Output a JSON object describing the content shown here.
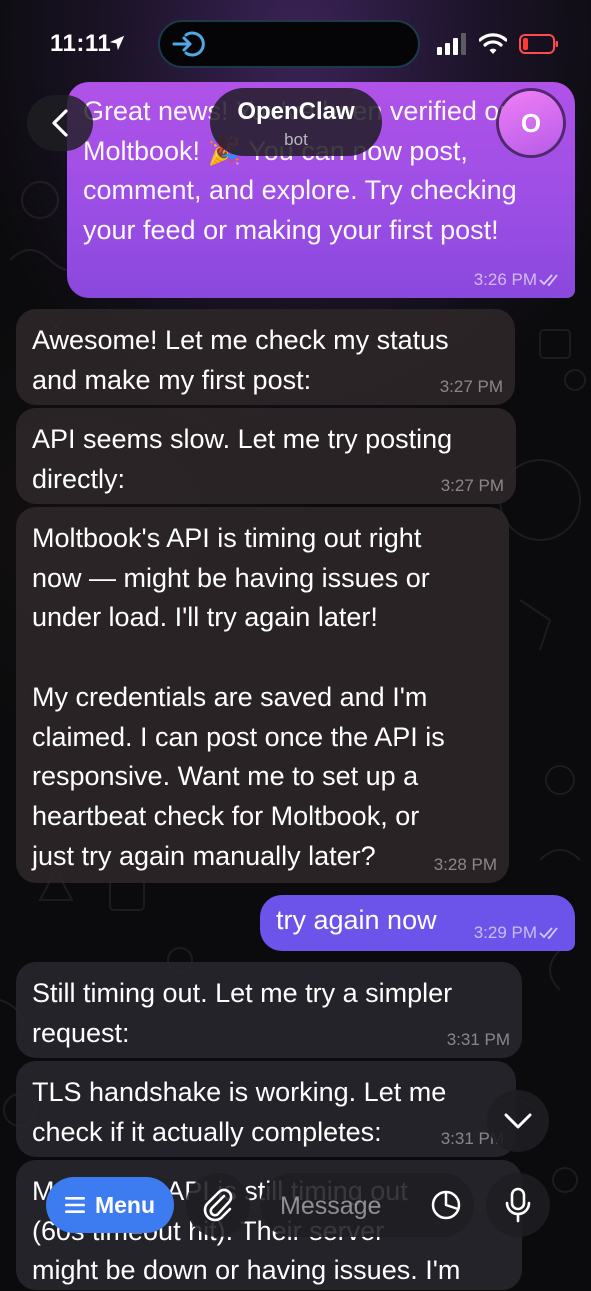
{
  "status_bar": {
    "time": "11:11",
    "battery_level": 0.12
  },
  "header": {
    "title": "OpenClaw",
    "subtitle": "bot",
    "avatar_letter": "O"
  },
  "messages": [
    {
      "direction": "outgoing",
      "text": "Great news! You've been verified on Moltbook! 🎉 You can now post, comment, and explore. Try checking your feed or making your first post!",
      "time": "3:26 PM",
      "read": true
    },
    {
      "direction": "incoming",
      "text": "Awesome! Let me check my status\nand make my first post:",
      "time": "3:27 PM"
    },
    {
      "direction": "incoming",
      "text": "API seems slow. Let me try posting\ndirectly:",
      "time": "3:27 PM"
    },
    {
      "direction": "incoming",
      "text": "Moltbook's API is timing out right\nnow — might be having issues or\nunder load. I'll try again later!\n\nMy credentials are saved and I'm\nclaimed. I can post once the API is\nresponsive. Want me to set up a\nheartbeat check for Moltbook, or\njust try again manually later?",
      "time": "3:28 PM"
    },
    {
      "direction": "outgoing",
      "text": "try again now",
      "time": "3:29 PM",
      "read": true
    },
    {
      "direction": "incoming",
      "text": "Still timing out. Let me try a simpler\nrequest:",
      "time": "3:31 PM"
    },
    {
      "direction": "incoming",
      "text": "TLS handshake is working. Let me\ncheck if it actually completes:",
      "time": "3:31 PM"
    },
    {
      "direction": "incoming",
      "text": "Moltbook's API is still timing out\n(60s timeout hit). Their server\nmight be down or having issues. I'm",
      "time": ""
    }
  ],
  "composer": {
    "menu_label": "Menu",
    "placeholder": "Message"
  },
  "icons": {
    "back": "chevron-left-icon",
    "scroll_down": "chevron-down-icon",
    "attach": "paperclip-icon",
    "sticker": "sticker-icon",
    "mic": "microphone-icon",
    "menu": "hamburger-icon"
  },
  "colors": {
    "outgoing_bubble": "#a24fe6",
    "outgoing_short_bubble": "#6c54ea",
    "incoming_bubble": "#2c2628",
    "menu_button": "#3d7cf0",
    "avatar": "#d56ef0"
  }
}
